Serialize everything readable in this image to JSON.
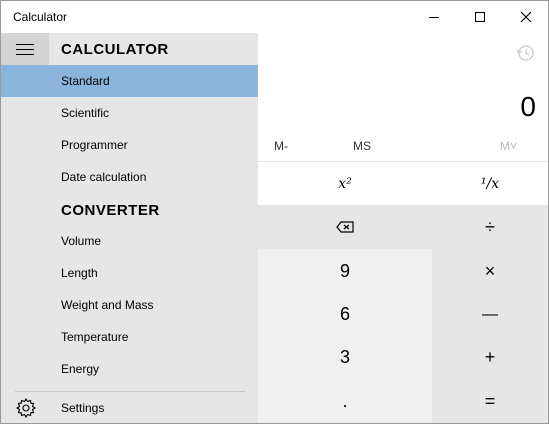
{
  "window": {
    "title": "Calculator",
    "minimize_icon": "minimize-icon",
    "maximize_icon": "maximize-icon",
    "close_icon": "close-icon"
  },
  "nav": {
    "calculator_heading": "CALCULATOR",
    "converter_heading": "CONVERTER",
    "calculator_items": [
      {
        "label": "Standard",
        "selected": true
      },
      {
        "label": "Scientific",
        "selected": false
      },
      {
        "label": "Programmer",
        "selected": false
      },
      {
        "label": "Date calculation",
        "selected": false
      }
    ],
    "converter_items": [
      {
        "label": "Volume"
      },
      {
        "label": "Length"
      },
      {
        "label": "Weight and Mass"
      },
      {
        "label": "Temperature"
      },
      {
        "label": "Energy"
      }
    ],
    "settings_label": "Settings",
    "selected_color": "#8ab4dc"
  },
  "calc": {
    "display": "0",
    "memory": {
      "m_minus": "M-",
      "ms": "MS",
      "m_list": "M˅"
    },
    "keys": {
      "square": "x²",
      "reciprocal": "¹/x",
      "backspace_icon": "backspace-icon",
      "divide": "÷",
      "nine": "9",
      "multiply": "×",
      "six": "6",
      "minus": "—",
      "three": "3",
      "plus": "+",
      "decimal": ".",
      "equals": "="
    }
  }
}
